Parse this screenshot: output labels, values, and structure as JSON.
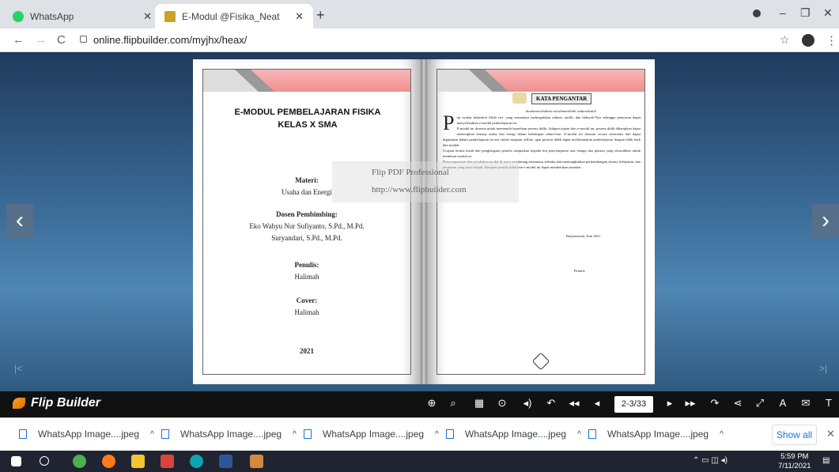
{
  "browser": {
    "tabs": [
      {
        "title": "WhatsApp",
        "favicon_color": "#25d366"
      },
      {
        "title": "E-Modul @Fisika_Neat",
        "favicon_color": "#c9a227"
      }
    ],
    "url": "online.flipbuilder.com/myjhx/heax/"
  },
  "book": {
    "left_page": {
      "title_line1": "E-MODUL PEMBELAJARAN FISIKA",
      "title_line2": "KELAS X SMA",
      "materi_label": "Materi:",
      "materi_value": "Usaha dan Energi",
      "dosen_label": "Dosen Pembimbing:",
      "dosen_1": "Eko Wahyu Nur Sufiyanto, S.Pd., M.Pd.",
      "dosen_2": "Suryandari, S.Pd., M.Pd.",
      "penulis_label": "Penulis:",
      "penulis_value": "Halimah",
      "cover_label": "Cover:",
      "cover_value": "Halimah",
      "year": "2021"
    },
    "right_page": {
      "heading": "KATA PENGANTAR",
      "greeting": "Assalamu'alaikum warahmatullahi wabarakatuh",
      "dropcap": "P",
      "paragraph1": "uji syukur kehadirat Allah swt. yang senantiasa melimpahkan rahmat, taufik, dan hidayah-Nya sehingga penyusun dapat menyelesaikan e-modul pembelajaran ini.",
      "paragraph2": "E-modul ini disusun untuk memenuhi keperluan peserta didik. Adapun tujuan dari e-modul ini, peserta didik diharapkan dapat menerapkan konsep usaha dan energi dalam kehidupan sehari-hari. E-modul ini disusun secara sistematis dan dapat digunakan dalam pembelajaran secara online maupun offline, agar peserta didik dapat melaksanakan pembelajaran dengan lebih baik dan mudah.",
      "paragraph3": "Ucapan terima kasih dan penghargaan penulis sampaikan kepada tim penyempurna atas tenaga dan pikiran yang dicurahkan untuk membuat modul ini.",
      "paragraph4": "Penyempurnaan dan perubahan modul di masa mendatang senantiasa terbuka dan memungkinkan perkembangan situasi, kebijakan, dan peraturan yang terus terjadi. Harapan penulis tidak lain e-modul ini dapat memberikan manfaat.",
      "place_date": "Banjarmasin, Juni 2021",
      "signature": "Penulis"
    },
    "watermark_line1": "Flip PDF Professional",
    "watermark_line2": "http://www.flipbuilder.com"
  },
  "viewer": {
    "brand": "Flip Builder",
    "page_indicator": "2-3/33"
  },
  "downloads": {
    "items": [
      "WhatsApp Image....jpeg",
      "WhatsApp Image....jpeg",
      "WhatsApp Image....jpeg",
      "WhatsApp Image....jpeg",
      "WhatsApp Image....jpeg"
    ],
    "show_all": "Show all"
  },
  "taskbar": {
    "time": "5:59 PM",
    "date": "7/11/2021"
  }
}
